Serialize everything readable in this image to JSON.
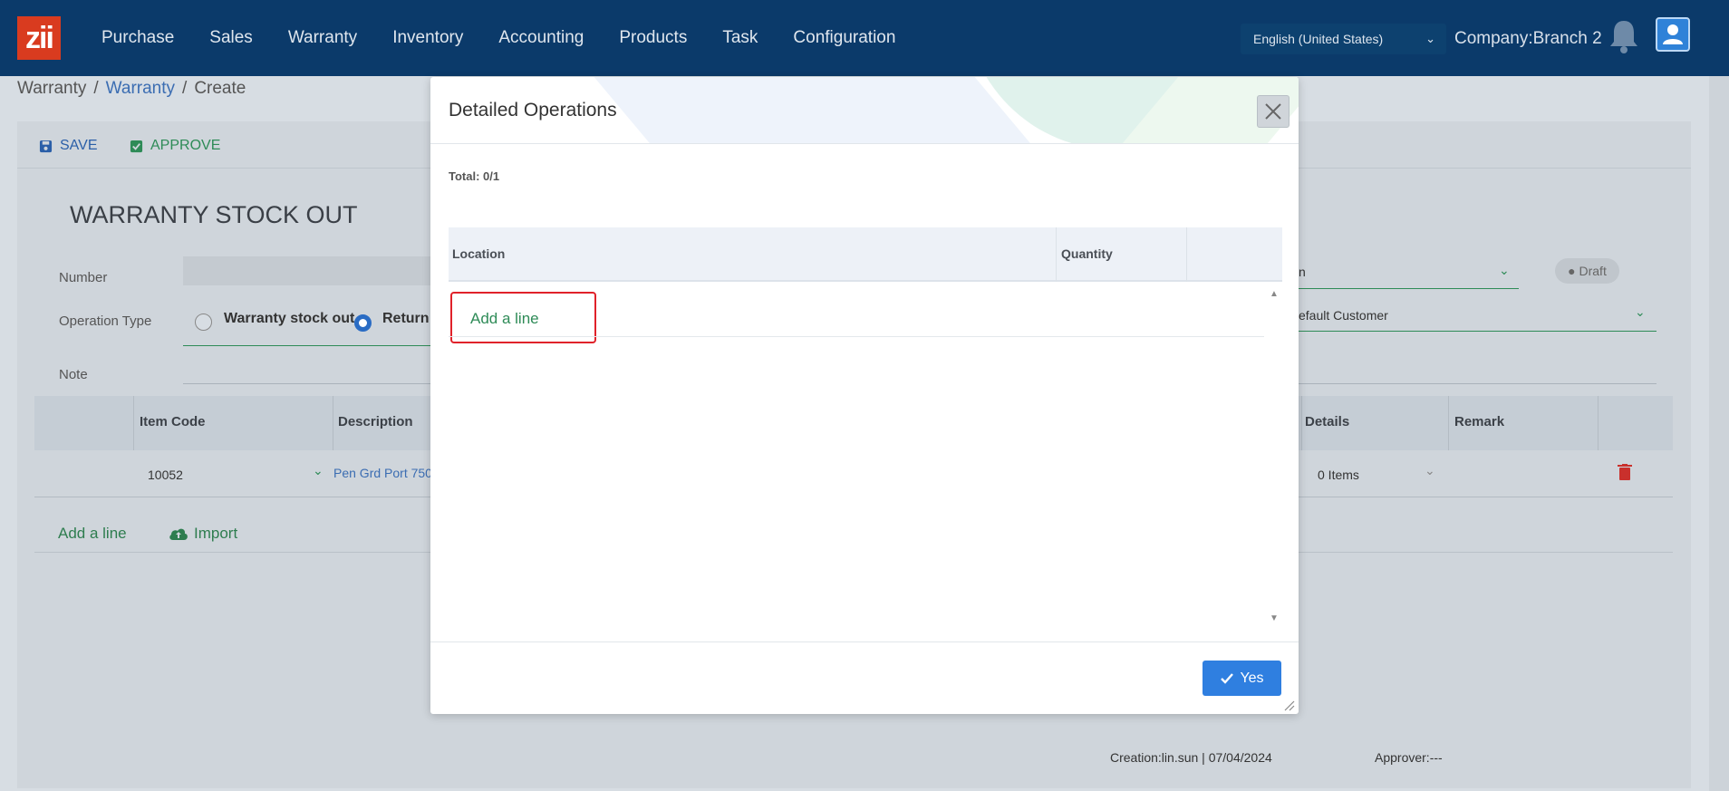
{
  "nav": {
    "items": [
      "Purchase",
      "Sales",
      "Warranty",
      "Inventory",
      "Accounting",
      "Products",
      "Task",
      "Configuration"
    ],
    "language": "English (United States)",
    "company": "Company:Branch 2"
  },
  "logo_text": "zii",
  "breadcrumb": {
    "root": "Warranty",
    "link": "Warranty",
    "current": "Create",
    "separator": "/"
  },
  "toolbar": {
    "save_label": "SAVE",
    "approve_label": "APPROVE"
  },
  "form": {
    "title": "WARRANTY STOCK OUT",
    "number_label": "Number",
    "operation_type_label": "Operation Type",
    "radio_warranty_stock_out": "Warranty stock out",
    "radio_return": "Return",
    "note_label": "Note",
    "right_select_1": "n",
    "right_select_2": "efault Customer",
    "status": "Draft"
  },
  "lines_table": {
    "headers": {
      "item_code": "Item Code",
      "description": "Description",
      "details": "Details",
      "remark": "Remark"
    },
    "rows": [
      {
        "item_code": "10052",
        "description": "Pen Grd Port 750",
        "details": "0 Items"
      }
    ],
    "add_line": "Add a line",
    "import": "Import"
  },
  "footer": {
    "creation": "Creation:lin.sun | 07/04/2024",
    "approver": "Approver:---"
  },
  "modal": {
    "title": "Detailed Operations",
    "total": "Total: 0/1",
    "columns": [
      "Location",
      "Quantity"
    ],
    "add_line": "Add a line",
    "confirm_label": "Yes"
  },
  "colors": {
    "nav_bg": "#0b3a6a",
    "accent_green": "#2e8b57",
    "primary_blue": "#2f7fe0",
    "highlight_red": "#e0222a"
  }
}
